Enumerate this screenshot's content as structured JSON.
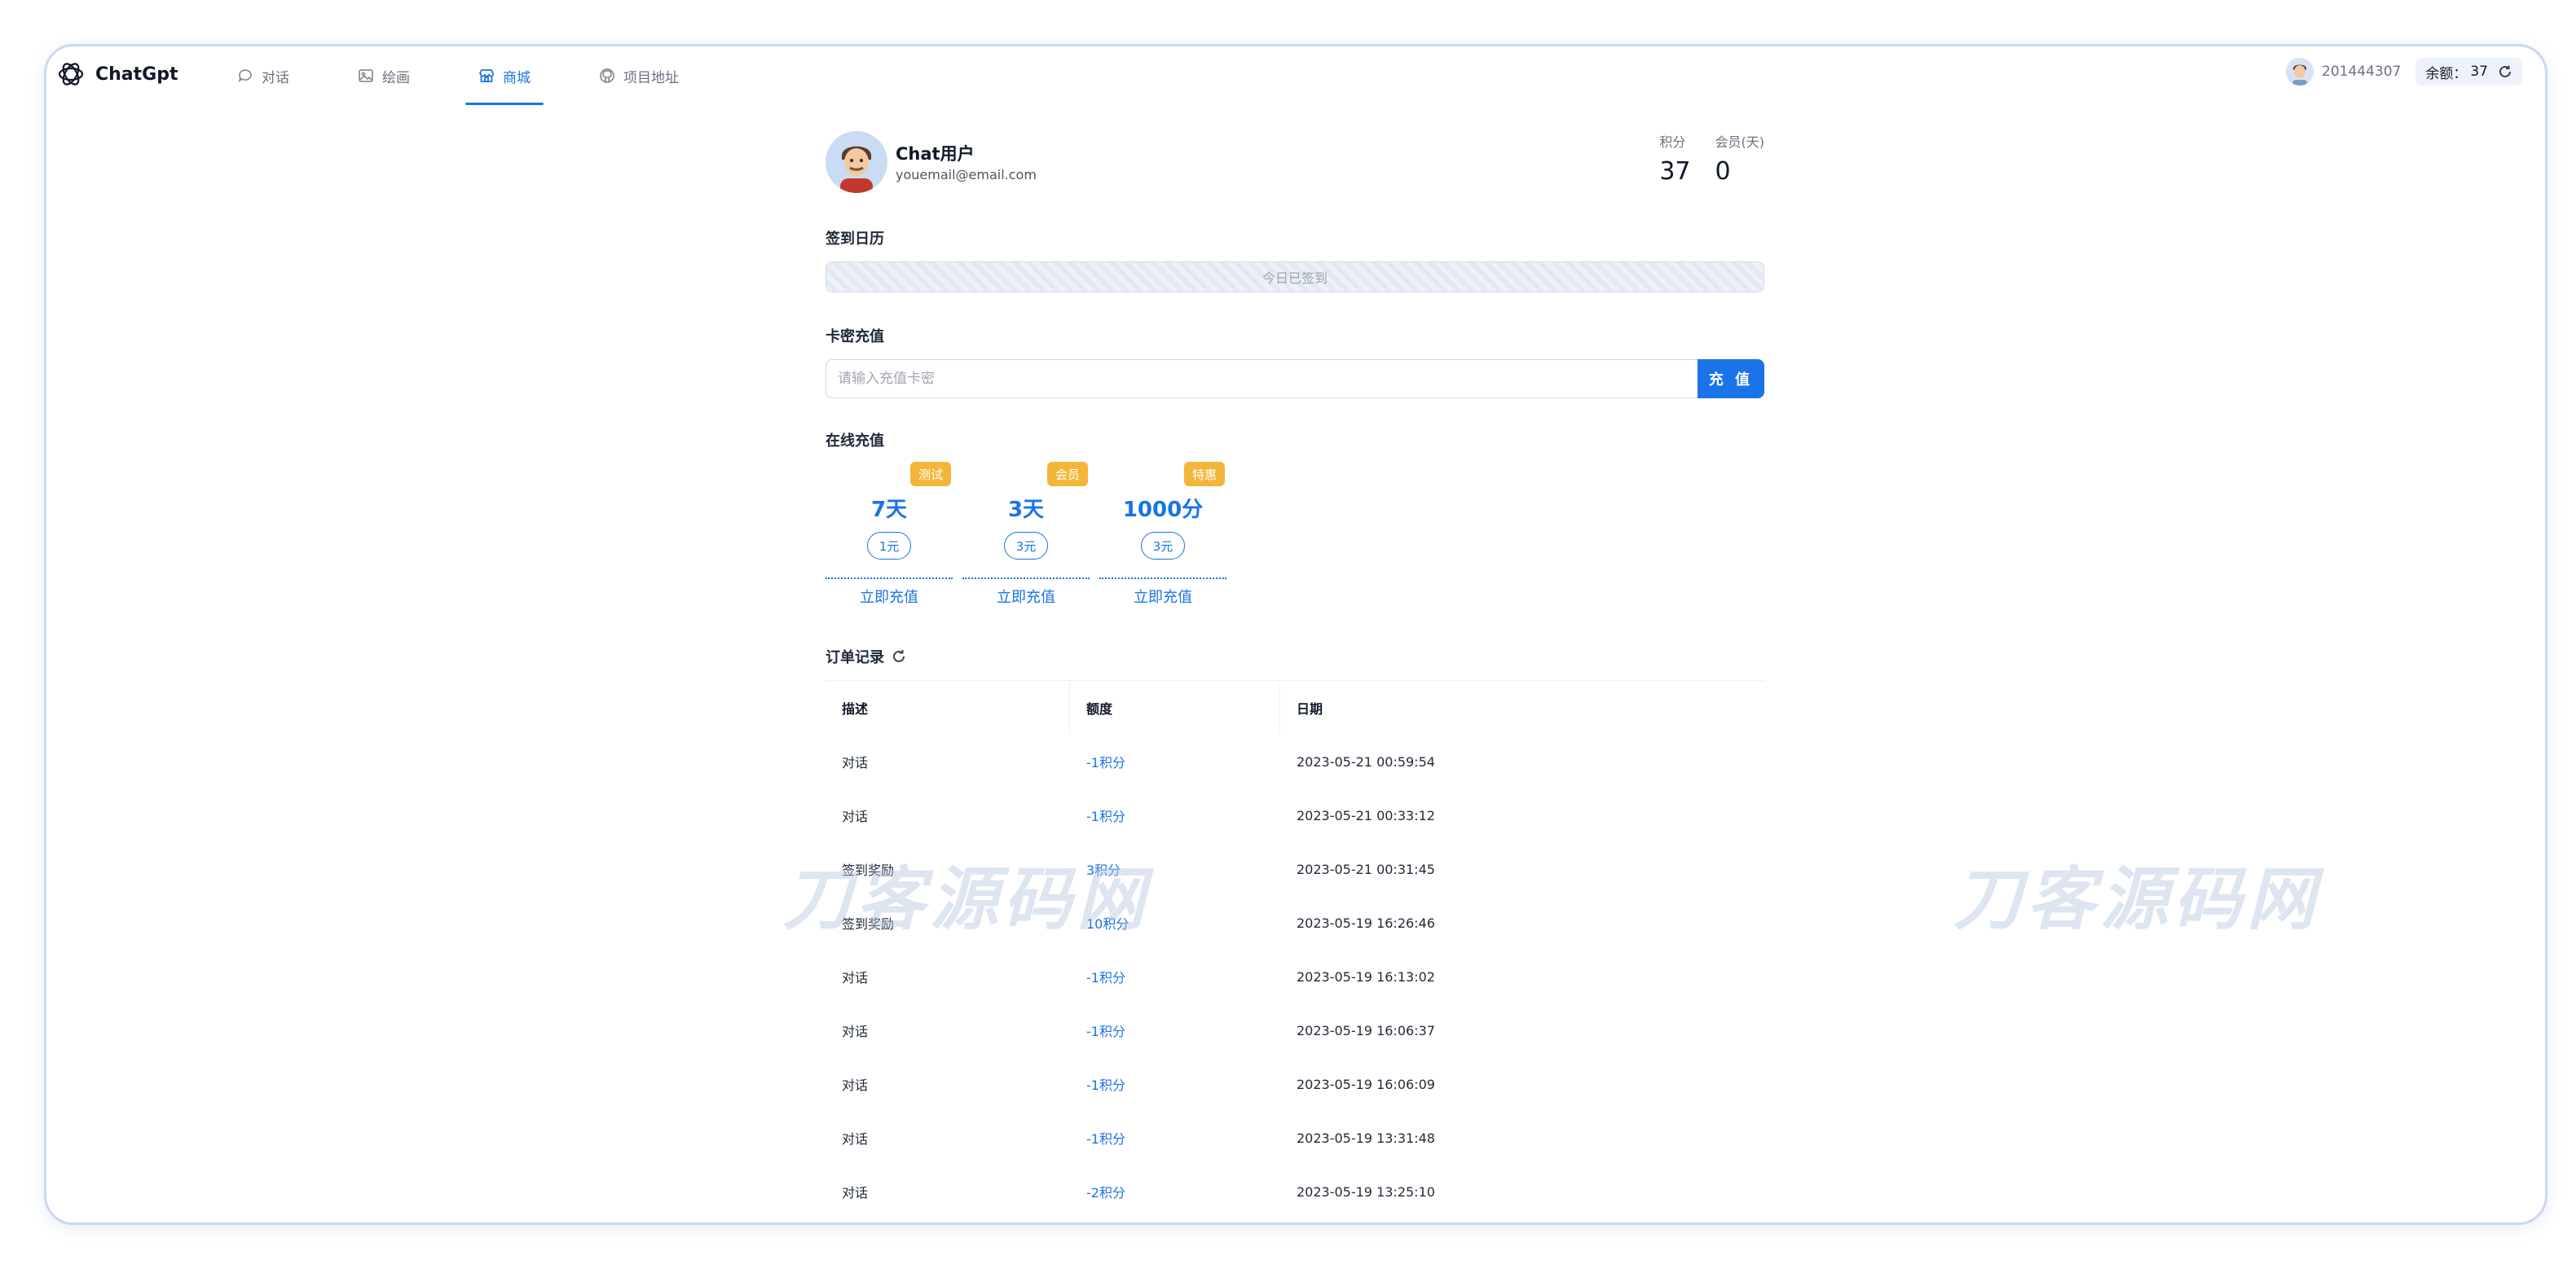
{
  "app": {
    "brand": "ChatGpt"
  },
  "nav": [
    {
      "label": "对话",
      "icon": "chat-bubble-icon",
      "active": false
    },
    {
      "label": "绘画",
      "icon": "image-icon",
      "active": false
    },
    {
      "label": "商城",
      "icon": "store-icon",
      "active": true
    },
    {
      "label": "项目地址",
      "icon": "github-icon",
      "active": false
    }
  ],
  "user_bar": {
    "user_id": "201444307",
    "balance_label": "余额：",
    "balance_value": "37"
  },
  "profile": {
    "name": "Chat用户",
    "email": "youemail@email.com"
  },
  "stats": [
    {
      "label": "积分",
      "value": "37"
    },
    {
      "label": "会员(天)",
      "value": "0"
    }
  ],
  "checkin": {
    "title": "签到日历",
    "status": "今日已签到"
  },
  "card_recharge": {
    "title": "卡密充值",
    "placeholder": "请输入充值卡密",
    "button": "充 值"
  },
  "online_recharge": {
    "title": "在线充值",
    "plans": [
      {
        "badge": "测试",
        "name": "7天",
        "price": "1元",
        "action": "立即充值"
      },
      {
        "badge": "会员",
        "name": "3天",
        "price": "3元",
        "action": "立即充值"
      },
      {
        "badge": "特惠",
        "name": "1000分",
        "price": "3元",
        "action": "立即充值"
      }
    ]
  },
  "orders": {
    "title": "订单记录",
    "columns": [
      "描述",
      "额度",
      "日期"
    ],
    "rows": [
      {
        "desc": "对话",
        "amount": "-1积分",
        "date": "2023-05-21 00:59:54"
      },
      {
        "desc": "对话",
        "amount": "-1积分",
        "date": "2023-05-21 00:33:12"
      },
      {
        "desc": "签到奖励",
        "amount": "3积分",
        "date": "2023-05-21 00:31:45"
      },
      {
        "desc": "签到奖励",
        "amount": "10积分",
        "date": "2023-05-19 16:26:46"
      },
      {
        "desc": "对话",
        "amount": "-1积分",
        "date": "2023-05-19 16:13:02"
      },
      {
        "desc": "对话",
        "amount": "-1积分",
        "date": "2023-05-19 16:06:37"
      },
      {
        "desc": "对话",
        "amount": "-1积分",
        "date": "2023-05-19 16:06:09"
      },
      {
        "desc": "对话",
        "amount": "-1积分",
        "date": "2023-05-19 13:31:48"
      },
      {
        "desc": "对话",
        "amount": "-2积分",
        "date": "2023-05-19 13:25:10"
      }
    ]
  },
  "watermark": "刀客源码网",
  "colors": {
    "accent": "#1a73e8",
    "badge": "#f4b63a"
  }
}
